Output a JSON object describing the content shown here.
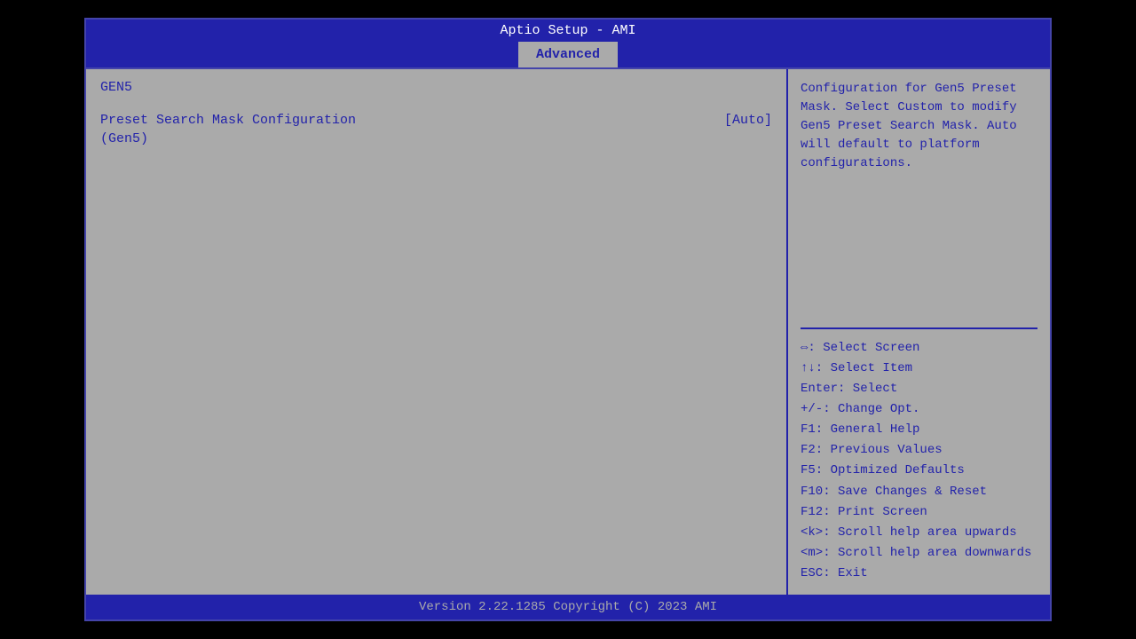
{
  "title": "Aptio Setup - AMI",
  "nav": {
    "tabs": [
      "Advanced"
    ]
  },
  "left_panel": {
    "section_title": "GEN5",
    "items": [
      {
        "label": "Preset Search Mask Configuration",
        "value": "[Auto]",
        "sub": "(Gen5)"
      }
    ]
  },
  "right_panel": {
    "help_text": "Configuration for Gen5 Preset Mask.  Select Custom to modify Gen5 Preset Search Mask.  Auto will default to platform configurations.",
    "shortcuts": [
      "⇔: Select Screen",
      "↑↓: Select Item",
      "Enter: Select",
      "+/-: Change Opt.",
      "F1: General Help",
      "F2: Previous Values",
      "F5: Optimized Defaults",
      "F10: Save Changes & Reset",
      "F12: Print Screen",
      "<k>: Scroll help area upwards",
      "<m>: Scroll help area downwards",
      "ESC: Exit"
    ]
  },
  "footer": {
    "text": "Version 2.22.1285 Copyright (C) 2023 AMI"
  }
}
